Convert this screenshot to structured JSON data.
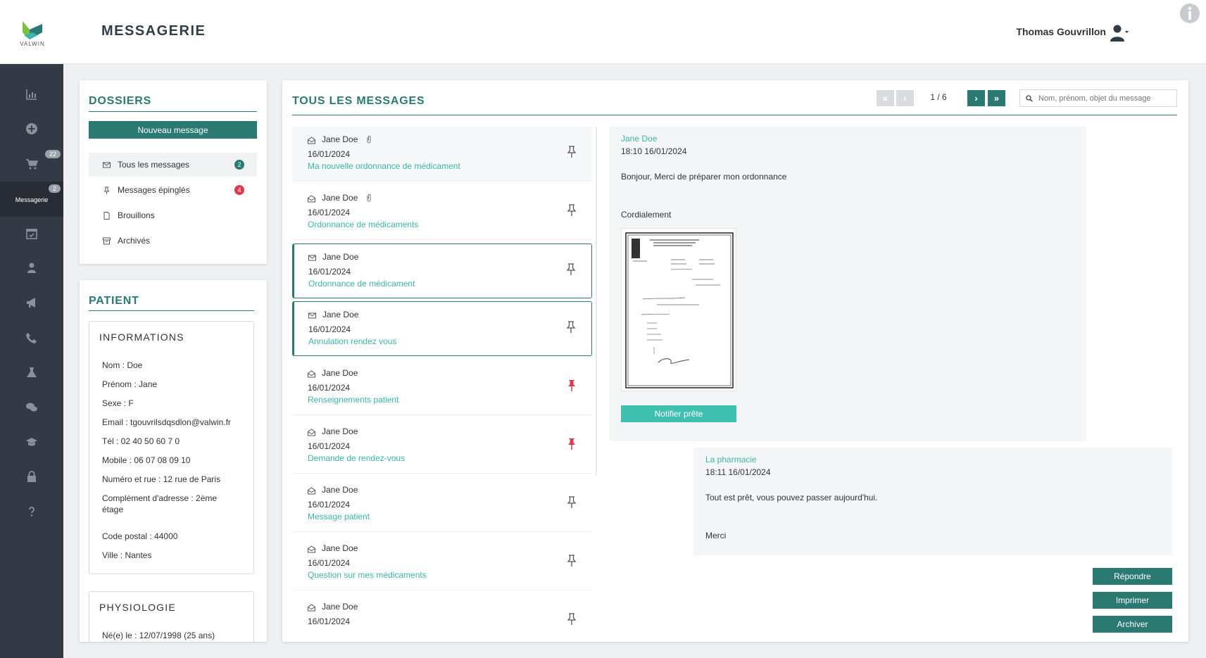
{
  "header": {
    "logo_text": "VALWIN",
    "page_title": "MESSAGERIE",
    "user_name": "Thomas Gouvrillon"
  },
  "sidebar": {
    "items": [
      {
        "icon": "chart-icon"
      },
      {
        "icon": "plus-circle-icon"
      },
      {
        "icon": "cart-icon",
        "badge": "22"
      },
      {
        "icon": "envelope-icon",
        "label": "Messagerie",
        "badge": "2",
        "active": true
      },
      {
        "icon": "calendar-check-icon"
      },
      {
        "icon": "user-icon"
      },
      {
        "icon": "megaphone-icon"
      },
      {
        "icon": "phone-icon"
      },
      {
        "icon": "flask-icon"
      },
      {
        "icon": "chat-icon"
      },
      {
        "icon": "graduation-cap-icon"
      },
      {
        "icon": "lock-icon"
      },
      {
        "icon": "question-icon"
      }
    ]
  },
  "dossiers": {
    "title": "DOSSIERS",
    "new_message": "Nouveau message",
    "items": [
      {
        "label": "Tous les messages",
        "badge": "2",
        "badge_color": "#2a7a73",
        "icon": "envelope-icon"
      },
      {
        "label": "Messages épinglés",
        "badge": "4",
        "badge_color": "#e0394b",
        "icon": "pin-icon"
      },
      {
        "label": "Brouillons",
        "icon": "file-icon"
      },
      {
        "label": "Archivés",
        "icon": "archive-icon"
      }
    ]
  },
  "patient": {
    "title": "PATIENT",
    "informations": {
      "title": "INFORMATIONS",
      "nom": "Nom : Doe",
      "prenom": "Prénom : Jane",
      "sexe": "Sexe : F",
      "email": "Email : tgouvrilsdqsdlon@valwin.fr",
      "tel": "Tél : 02 40 50 60 7 0",
      "mobile": "Mobile : 06 07 08 09 10",
      "rue": "Numéro et rue : 12 rue de Paris",
      "complement": "Complément d'adresse : 2ème étage",
      "cp": "Code postal : 44000",
      "ville": "Ville : Nantes"
    },
    "physiologie": {
      "title": "PHYSIOLOGIE",
      "naissance": "Né(e) le : 12/07/1998 (25 ans)"
    }
  },
  "messages": {
    "title": "TOUS LES MESSAGES",
    "pager": {
      "first": "«",
      "prev": "‹",
      "info": "1 / 6",
      "next": "›",
      "last": "»"
    },
    "search_placeholder": "Nom, prénom, objet du message",
    "list": [
      {
        "sender": "Jane Doe",
        "date": "16/01/2024",
        "subject": "Ma nouvelle ordonnance de médicament",
        "read": true,
        "attachment": true,
        "pinned": false,
        "highlight": true
      },
      {
        "sender": "Jane Doe",
        "date": "16/01/2024",
        "subject": "Ordonnance de médicaments",
        "read": true,
        "attachment": true,
        "pinned": false
      },
      {
        "sender": "Jane Doe",
        "date": "16/01/2024",
        "subject": "Ordonnance de médicament",
        "read": false,
        "pinned": false,
        "selected": true
      },
      {
        "sender": "Jane Doe",
        "date": "16/01/2024",
        "subject": "Annulation rendez vous",
        "read": false,
        "pinned": false,
        "selected": true
      },
      {
        "sender": "Jane Doe",
        "date": "16/01/2024",
        "subject": "Renseignements patient",
        "read": true,
        "pinned": true
      },
      {
        "sender": "Jane Doe",
        "date": "16/01/2024",
        "subject": "Demande de rendez-vous",
        "read": true,
        "pinned": true
      },
      {
        "sender": "Jane Doe",
        "date": "16/01/2024",
        "subject": "Message patient",
        "read": true,
        "pinned": false
      },
      {
        "sender": "Jane Doe",
        "date": "16/01/2024",
        "subject": "Question sur mes médicaments",
        "read": true,
        "pinned": false
      },
      {
        "sender": "Jane Doe",
        "date": "16/01/2024",
        "subject": "",
        "read": true,
        "pinned": false
      }
    ]
  },
  "conversation": {
    "patient_msg": {
      "sender": "Jane Doe",
      "time": "18:10 16/01/2024",
      "line1": "Bonjour, Merci de préparer mon ordonnance",
      "line2": "Cordialement",
      "notify_button": "Notifier prête"
    },
    "pharmacy_msg": {
      "sender": "La pharmacie",
      "time": "18:11 16/01/2024",
      "line1": "Tout est prêt, vous pouvez passer aujourd'hui.",
      "line2": "Merci"
    },
    "actions": {
      "reply": "Répondre",
      "print": "Imprimer",
      "archive": "Archiver"
    }
  },
  "colors": {
    "primary": "#2a7a73",
    "accent": "#3bb5a8",
    "pinned": "#e0394b",
    "sidebar": "#343a45"
  }
}
